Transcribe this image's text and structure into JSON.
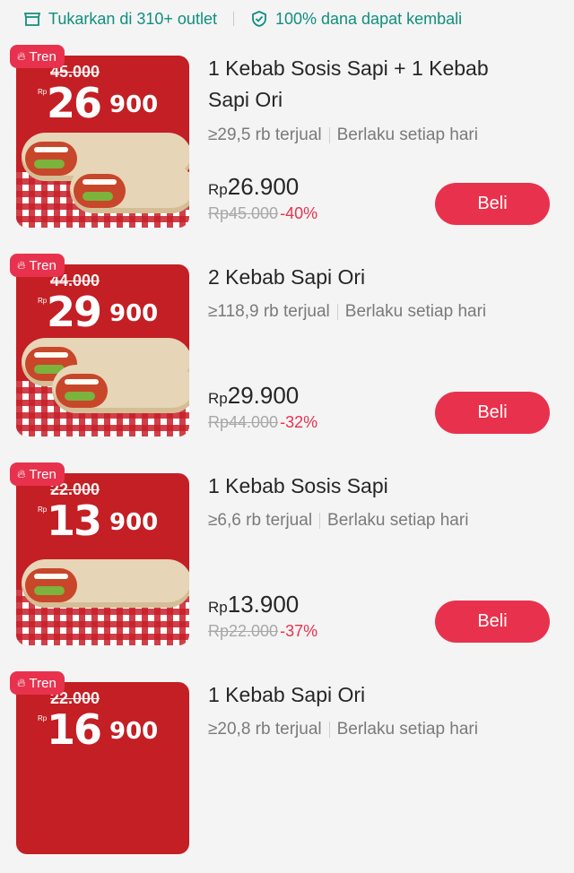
{
  "header": {
    "outlet_text": "Tukarkan di 310+ outlet",
    "refund_text": "100% dana dapat kembali",
    "outlet_icon": "store-icon",
    "refund_icon": "shield-check-icon"
  },
  "colors": {
    "accent": "#e8324d",
    "teal": "#0f8f7e",
    "thumb_bg": "#c31f24"
  },
  "items": [
    {
      "badge": "Tren",
      "thumb_old": "45.000",
      "thumb_rp": "Rp",
      "thumb_big": "26",
      "thumb_small": "900",
      "title_line1": "1 Kebab Sosis Sapi + 1 Kebab",
      "title_line2": "Sapi Ori",
      "sold": "≥29,5 rb terjual",
      "validity": "Berlaku setiap hari",
      "currency": "Rp",
      "price": "26.900",
      "old_price": "Rp45.000",
      "discount": "-40%",
      "button": "Beli"
    },
    {
      "badge": "Tren",
      "thumb_old": "44.000",
      "thumb_rp": "Rp",
      "thumb_big": "29",
      "thumb_small": "900",
      "title_line1": "2 Kebab Sapi Ori",
      "title_line2": "",
      "sold": "≥118,9 rb terjual",
      "validity": "Berlaku setiap hari",
      "currency": "Rp",
      "price": "29.900",
      "old_price": "Rp44.000",
      "discount": "-32%",
      "button": "Beli"
    },
    {
      "badge": "Tren",
      "thumb_old": "22.000",
      "thumb_rp": "Rp",
      "thumb_big": "13",
      "thumb_small": "900",
      "title_line1": "1 Kebab Sosis Sapi",
      "title_line2": "",
      "sold": "≥6,6 rb terjual",
      "validity": "Berlaku setiap hari",
      "currency": "Rp",
      "price": "13.900",
      "old_price": "Rp22.000",
      "discount": "-37%",
      "button": "Beli"
    },
    {
      "badge": "Tren",
      "thumb_old": "22.000",
      "thumb_rp": "Rp",
      "thumb_big": "16",
      "thumb_small": "900",
      "title_line1": "1 Kebab Sapi Ori",
      "title_line2": "",
      "sold": "≥20,8 rb terjual",
      "validity": "Berlaku setiap hari",
      "currency": "Rp",
      "price": "",
      "old_price": "",
      "discount": "",
      "button": ""
    }
  ]
}
